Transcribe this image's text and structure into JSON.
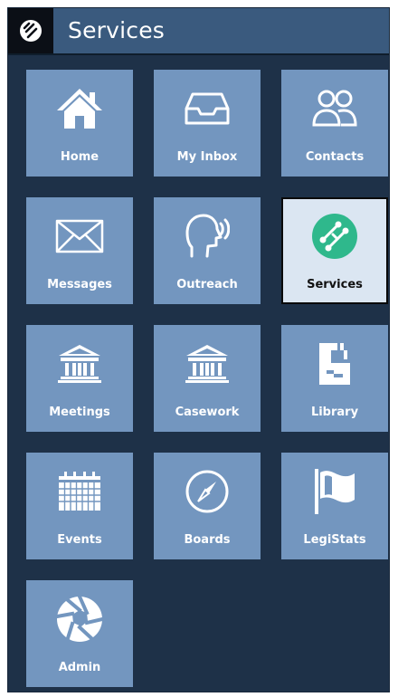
{
  "header": {
    "title": "Services",
    "logo_icon": "services-logo-icon"
  },
  "colors": {
    "frame_bg": "#1e3148",
    "header_bg": "#3a5a7e",
    "tile_bg": "#7396bf",
    "active_tile_bg": "#dbe6f2",
    "active_icon": "#2fb88c"
  },
  "tiles": [
    {
      "label": "Home",
      "icon": "home-icon",
      "active": false
    },
    {
      "label": "My Inbox",
      "icon": "inbox-icon",
      "active": false
    },
    {
      "label": "Contacts",
      "icon": "contacts-icon",
      "active": false
    },
    {
      "label": "Messages",
      "icon": "envelope-icon",
      "active": false
    },
    {
      "label": "Outreach",
      "icon": "speaking-person-icon",
      "active": false
    },
    {
      "label": "Services",
      "icon": "services-network-icon",
      "active": true
    },
    {
      "label": "Meetings",
      "icon": "building-icon",
      "active": false
    },
    {
      "label": "Casework",
      "icon": "building-icon",
      "active": false
    },
    {
      "label": "Library",
      "icon": "library-icon",
      "active": false
    },
    {
      "label": "Events",
      "icon": "calendar-icon",
      "active": false
    },
    {
      "label": "Boards",
      "icon": "compass-icon",
      "active": false
    },
    {
      "label": "LegiStats",
      "icon": "flag-icon",
      "active": false
    },
    {
      "label": "Admin",
      "icon": "aperture-icon",
      "active": false
    }
  ]
}
